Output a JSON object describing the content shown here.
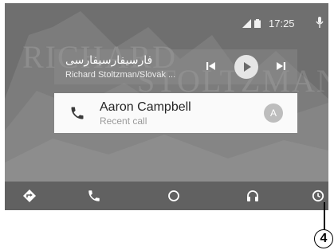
{
  "background_watermark": {
    "line1": "RICHARD",
    "line2": "STOLTZMAN"
  },
  "status_bar": {
    "time": "17:25"
  },
  "media_card": {
    "title": "فارسيفارسيفارسى",
    "subtitle": "Richard Stoltzman/Slovak ..."
  },
  "recent_call": {
    "name": "Aaron Campbell",
    "subtitle": "Recent call",
    "avatar_initial": "A"
  },
  "callout": {
    "number": "4"
  },
  "colors": {
    "screen_bg": "#6f6f6f",
    "navbar_bg": "#616161",
    "card_bg": "#fafafa"
  }
}
